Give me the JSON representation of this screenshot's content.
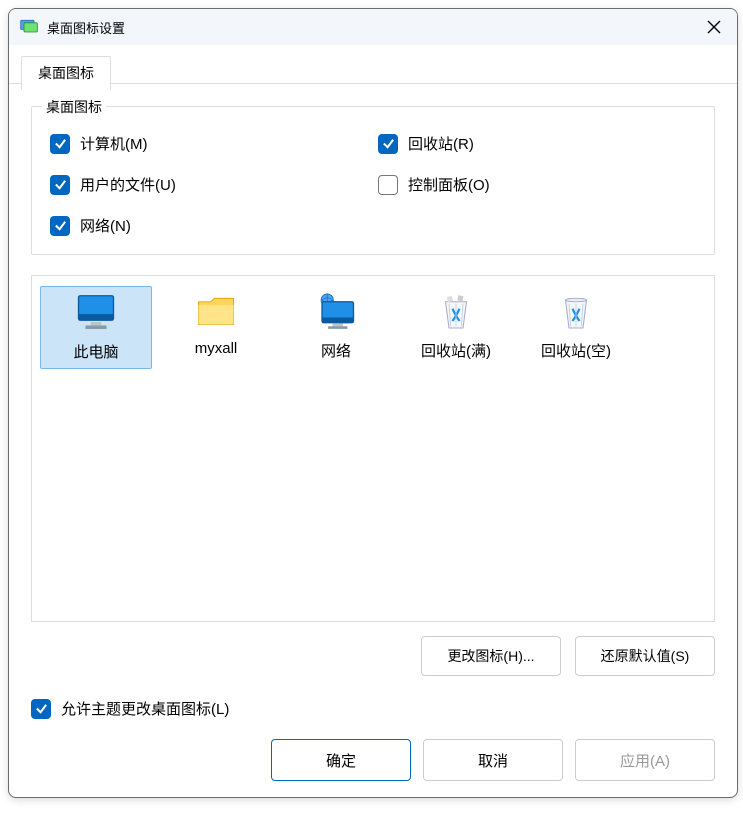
{
  "titlebar": {
    "title": "桌面图标设置"
  },
  "tab": {
    "label": "桌面图标"
  },
  "group": {
    "title": "桌面图标",
    "checkboxes": {
      "computer": {
        "label": "计算机(M)",
        "checked": true
      },
      "recycle": {
        "label": "回收站(R)",
        "checked": true
      },
      "userfiles": {
        "label": "用户的文件(U)",
        "checked": true
      },
      "cpl": {
        "label": "控制面板(O)",
        "checked": false
      },
      "network": {
        "label": "网络(N)",
        "checked": true
      }
    }
  },
  "icons": {
    "thispc": {
      "label": "此电脑"
    },
    "userfolder": {
      "label": "myxall"
    },
    "network": {
      "label": "网络"
    },
    "recycle_full": {
      "label": "回收站(满)"
    },
    "recycle_empty": {
      "label": "回收站(空)"
    }
  },
  "buttons": {
    "change_icon": "更改图标(H)...",
    "restore_default": "还原默认值(S)"
  },
  "allow_theme": {
    "label": "允许主题更改桌面图标(L)",
    "checked": true
  },
  "bottom": {
    "ok": "确定",
    "cancel": "取消",
    "apply": "应用(A)"
  }
}
